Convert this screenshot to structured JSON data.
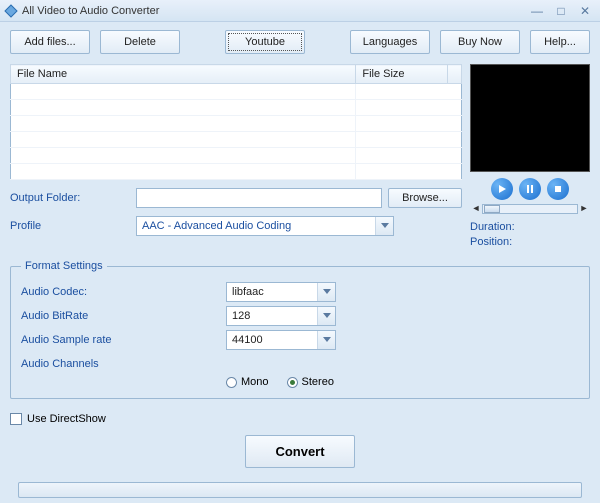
{
  "window": {
    "title": "All Video to Audio Converter"
  },
  "toolbar": {
    "add_files": "Add files...",
    "delete": "Delete",
    "youtube": "Youtube",
    "languages": "Languages",
    "buy_now": "Buy Now",
    "help": "Help..."
  },
  "table": {
    "headers": {
      "file_name": "File Name",
      "file_size": "File Size"
    },
    "rows": []
  },
  "preview": {
    "duration_label": "Duration:",
    "position_label": "Position:"
  },
  "output": {
    "label": "Output Folder:",
    "value": "",
    "browse": "Browse..."
  },
  "profile": {
    "label": "Profile",
    "value": "AAC - Advanced Audio Coding"
  },
  "format": {
    "legend": "Format Settings",
    "codec_label": "Audio Codec:",
    "codec_value": "libfaac",
    "bitrate_label": "Audio BitRate",
    "bitrate_value": "128",
    "sample_label": "Audio Sample rate",
    "sample_value": "44100",
    "channels_label": "Audio Channels",
    "mono": "Mono",
    "stereo": "Stereo",
    "selected_channel": "stereo"
  },
  "directshow": {
    "label": "Use DirectShow",
    "checked": false
  },
  "convert": "Convert"
}
